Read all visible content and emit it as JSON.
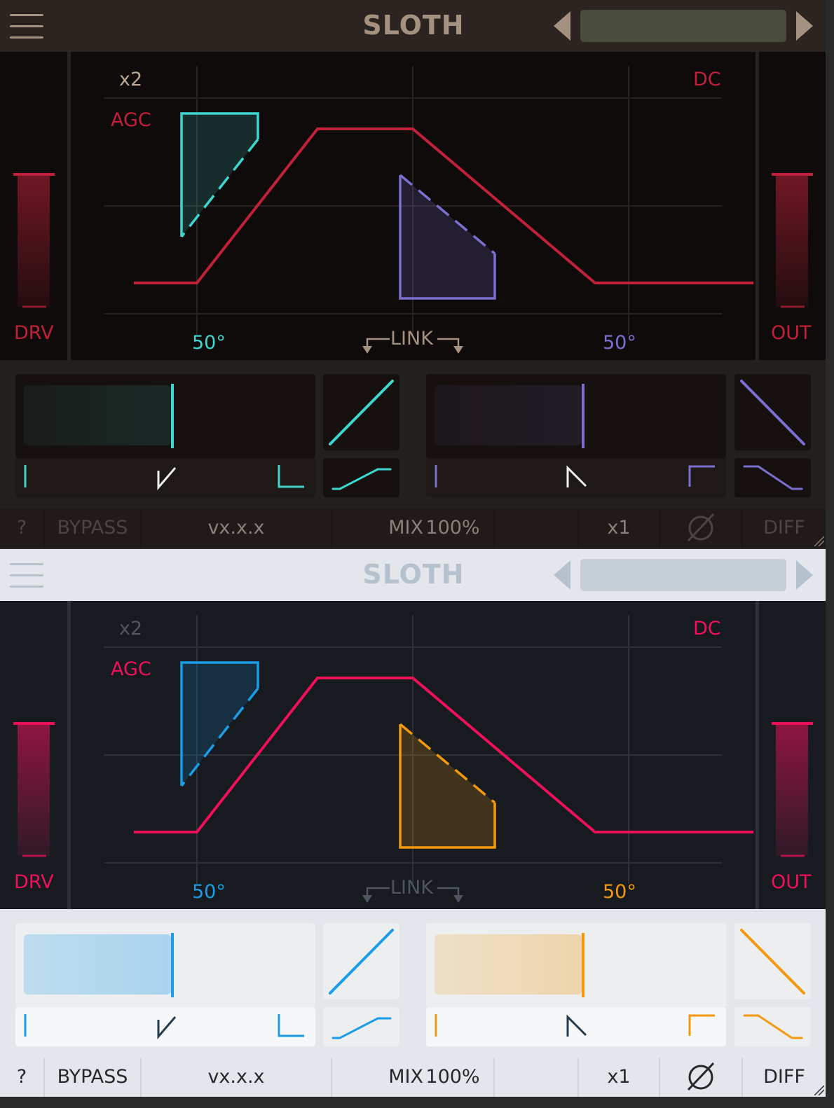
{
  "header": {
    "menu_icon": "hamburger-menu-icon",
    "title": "SLOTH",
    "prev_icon": "triangle-left-icon",
    "next_icon": "triangle-right-icon",
    "preset_value": ""
  },
  "graph": {
    "oversample_label": "x2",
    "dc_label": "DC",
    "agc_label": "AGC",
    "drive_label": "DRV",
    "output_label": "OUT",
    "left_angle": "50°",
    "right_angle": "50°",
    "link_label": "LINK",
    "link_icon": "link-bracket-arrows-icon"
  },
  "controls": {
    "left_slider_level": 0.52,
    "right_slider_level": 0.52,
    "left_mode_icons": [
      "bar-icon",
      "v-shape-icon",
      "corner-icon"
    ],
    "right_mode_icons": [
      "bar-icon",
      "peak-icon",
      "corner-icon"
    ],
    "left_curve_icon": "diagonal-rise-icon",
    "left_shape_icon": "soft-rise-icon",
    "right_curve_icon": "diagonal-fall-icon",
    "right_shape_icon": "soft-fall-icon"
  },
  "footer": {
    "help": "?",
    "bypass": "BYPASS",
    "version": "vx.x.x",
    "mix_label": "MIX",
    "mix_value": "100%",
    "oversample": "x1",
    "phase_icon": "phase-invert-icon",
    "diff": "DIFF"
  },
  "themes": {
    "dark": {
      "header_bg": "#2b2420",
      "title": "#a5917f",
      "arrows": "#a5917f",
      "preset_bg": "#494c3a",
      "graph_bg": "#0e0b0a",
      "grid": "#272220",
      "accent": "#c1203a",
      "left": "#3fd6cf",
      "right": "#7b6fd0",
      "x2": "#b7a793",
      "link": "#a5917f",
      "ctrl_bg": "#231f1d",
      "box_bg": "#16110f",
      "strip_bg": "#1e1917",
      "mode_mid": "#f0f0f0",
      "footer_bg": "#201b19",
      "footer_text": "#4c4440",
      "footer_hi": "#8a7f79",
      "footer_div": "#1a1614"
    },
    "light": {
      "header_bg": "#e3e6ea",
      "title": "#b5c1cd",
      "arrows": "#b5c1cd",
      "preset_bg": "#c6ced6",
      "graph_bg": "#171b20",
      "grid": "#2c3138",
      "accent": "#f0105a",
      "left": "#1a9de6",
      "right": "#f2990f",
      "x2": "#4e555e",
      "link": "#4e555e",
      "ctrl_bg": "#e3e6ea",
      "box_bg": "#eceef0",
      "strip_bg": "#f6f7f8",
      "mode_mid": "#253b4a",
      "footer_bg": "#e3e6ea",
      "footer_text": "#26292c",
      "footer_hi": "#26292c",
      "footer_div": "#cfd4d9"
    }
  }
}
